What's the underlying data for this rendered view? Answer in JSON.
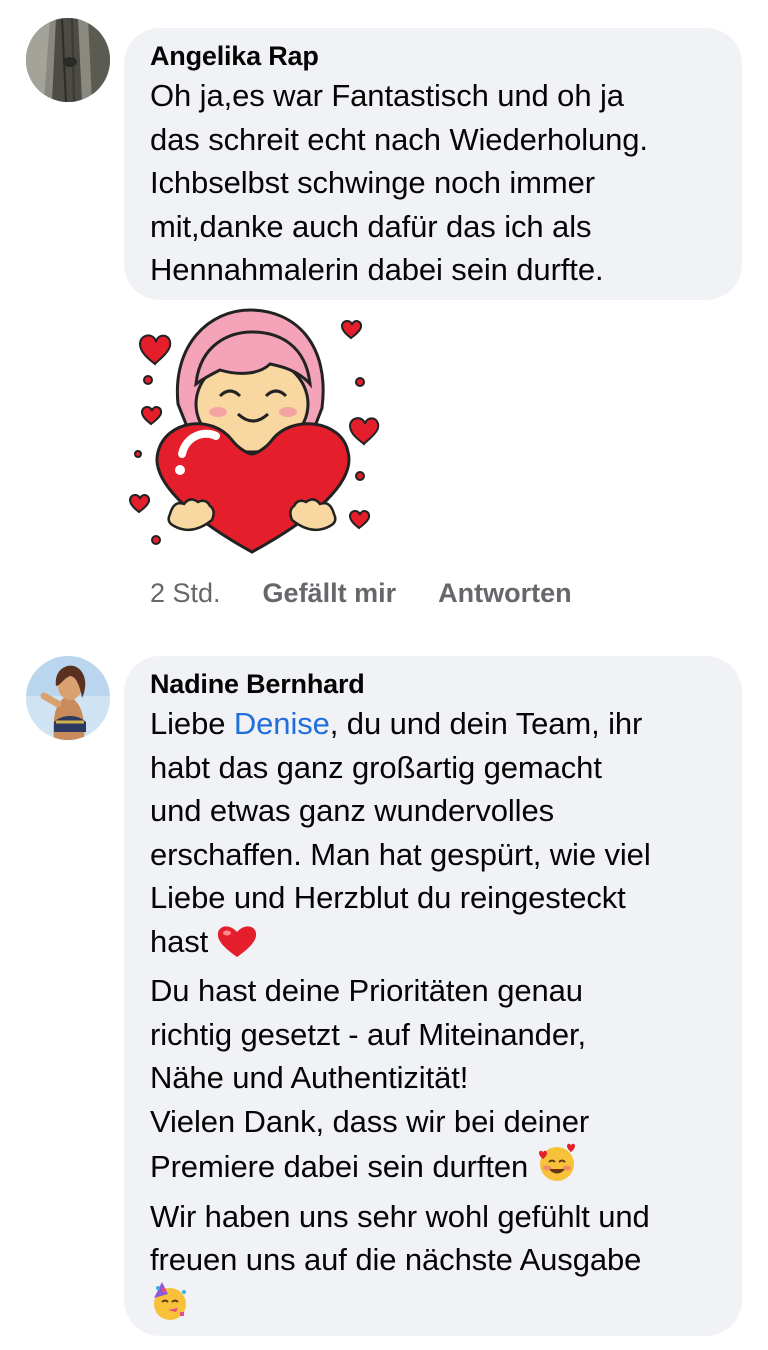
{
  "comments": [
    {
      "author": "Angelika Rap",
      "lines": [
        "Oh ja,es war Fantastisch und oh ja",
        "das schreit echt nach Wiederholung.",
        "Ichbselbst schwinge noch immer",
        "mit,danke auch dafür das ich als",
        "Hennahmalerin dabei sein durfte."
      ],
      "sticker": "heart-hug-sticker",
      "actions": {
        "time": "2 Std.",
        "like": "Gefällt mir",
        "reply": "Antworten"
      }
    },
    {
      "author": "Nadine Bernhard",
      "line1_pre": "Liebe ",
      "mention": "Denise",
      "line1_post": ", du und dein Team, ihr",
      "lines_a": [
        "habt das ganz großartig gemacht",
        "und etwas ganz wundervolles",
        "erschaffen. Man hat gespürt, wie viel",
        "Liebe und Herzblut du reingesteckt"
      ],
      "line_hast": "hast ",
      "emoji_heart": "red-heart-icon",
      "lines_b": [
        "Du hast deine Prioritäten genau",
        "richtig gesetzt - auf Miteinander,",
        "Nähe und Authentizität!",
        "Vielen Dank, dass wir bei deiner"
      ],
      "line_premiere": "Premiere dabei sein durften ",
      "emoji_hearts_face": "smiling-face-with-hearts-icon",
      "lines_c": [
        "Wir haben uns sehr wohl gefühlt und",
        "freuen uns auf die nächste Ausgabe"
      ],
      "emoji_party": "partying-face-icon"
    }
  ],
  "colors": {
    "bubble": "#f0f2f5",
    "mention": "#216fdb",
    "meta": "#65676b",
    "heart": "#e41e2b"
  }
}
